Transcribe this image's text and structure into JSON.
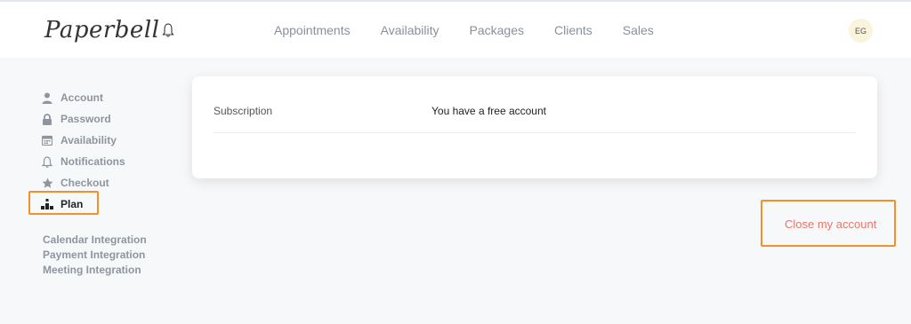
{
  "header": {
    "logo_text": "Paperbell",
    "nav": [
      "Appointments",
      "Availability",
      "Packages",
      "Clients",
      "Sales"
    ],
    "avatar_initials": "EG"
  },
  "sidebar": {
    "items": [
      {
        "label": "Account",
        "icon": "user-icon"
      },
      {
        "label": "Password",
        "icon": "lock-icon"
      },
      {
        "label": "Availability",
        "icon": "calendar-icon"
      },
      {
        "label": "Notifications",
        "icon": "bell-icon"
      },
      {
        "label": "Checkout",
        "icon": "star-icon"
      },
      {
        "label": "Plan",
        "icon": "plan-icon",
        "active": true
      }
    ],
    "integrations": [
      "Calendar Integration",
      "Payment Integration",
      "Meeting Integration"
    ]
  },
  "subscription": {
    "label": "Subscription",
    "value": "You have a free account"
  },
  "close_account": {
    "label": "Close my account"
  },
  "colors": {
    "highlight_border": "#f0922b",
    "close_link": "#e8776a",
    "avatar_bg": "#fbf4dc"
  }
}
